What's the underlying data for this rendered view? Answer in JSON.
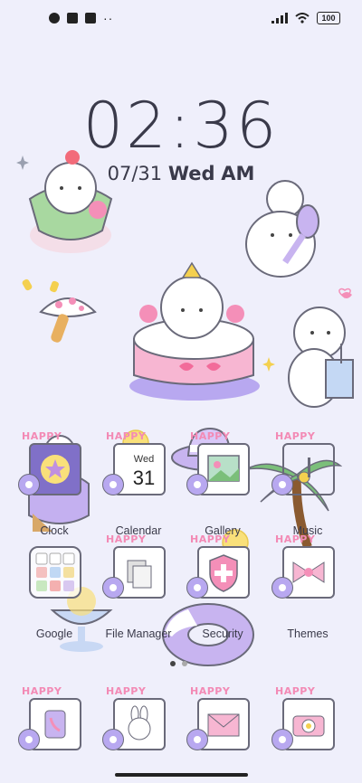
{
  "status_bar": {
    "battery": "100"
  },
  "clock": {
    "time": "02:36",
    "date": "07/31",
    "weekday": "Wed",
    "ampm": "AM"
  },
  "apps_row1": [
    {
      "label": "Clock"
    },
    {
      "label": "Calendar",
      "day": "Wed",
      "date": "31"
    },
    {
      "label": "Gallery"
    },
    {
      "label": "Music"
    }
  ],
  "apps_row2": [
    {
      "label": "Google"
    },
    {
      "label": "File Manager"
    },
    {
      "label": "Security"
    },
    {
      "label": "Themes"
    }
  ],
  "dock_badge": "HAPPY",
  "colors": {
    "background": "#efeffb",
    "accent_pink": "#f38ab5",
    "accent_purple": "#b8a8f0"
  }
}
